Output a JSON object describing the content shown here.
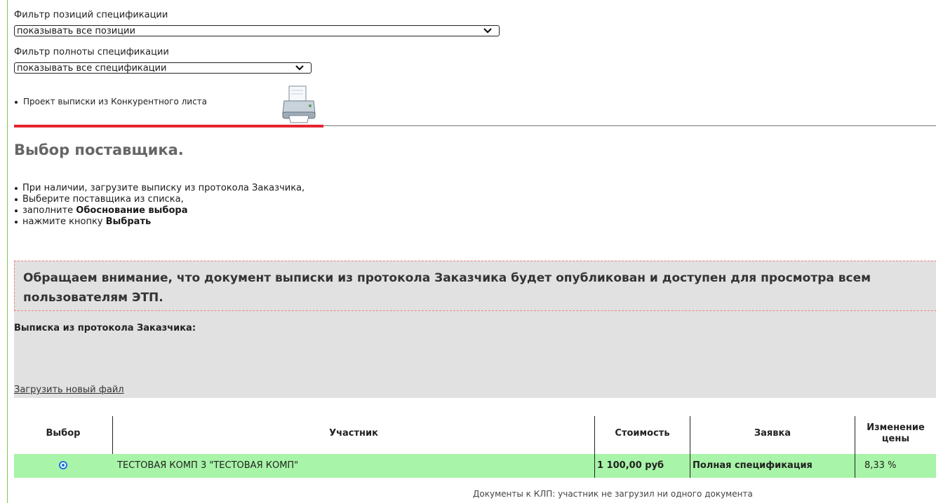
{
  "filters": {
    "positions_label": "Фильтр позиций спецификации",
    "positions_value": "показывать все позиции",
    "completeness_label": "Фильтр полноты спецификации",
    "completeness_value": "показывать все спецификации"
  },
  "print": {
    "text": "Проект выписки из Конкурентного листа",
    "icon": "printer-icon"
  },
  "section": {
    "title": "Выбор поставщика.",
    "instructions": [
      {
        "pre": "При наличии, загрузите выписку из протокола Заказчика,",
        "bold": ""
      },
      {
        "pre": "Выберите поставщика из списка,",
        "bold": ""
      },
      {
        "pre": "заполните ",
        "bold": "Обоснование выбора"
      },
      {
        "pre": "нажмите кнопку ",
        "bold": "Выбрать"
      }
    ]
  },
  "notice": {
    "text": "Обращаем внимание, что документ выписки из протокола Заказчика будет опубликован и доступен для просмотра всем пользователям ЭТП."
  },
  "protocol": {
    "label": "Выписка из протокола Заказчика:",
    "upload_link": "Загрузить новый файл"
  },
  "table": {
    "headers": [
      "Выбор",
      "Участник",
      "Стоимость",
      "Заявка",
      "Изменение цены"
    ],
    "rows": [
      {
        "selected": true,
        "participant": "ТЕСТОВАЯ КОМП 3 \"ТЕСТОВАЯ КОМП\"",
        "cost": "1 100,00 руб",
        "application": "Полная спецификация",
        "price_change": "8,33 %"
      }
    ],
    "row_color": "#a8f4a8"
  },
  "docs": {
    "label": "Документы к КЛП:",
    "value": "участник не загрузил ни одного документа"
  },
  "colors": {
    "accent_red": "#e3262f",
    "radio_blue": "#1a73e8"
  }
}
